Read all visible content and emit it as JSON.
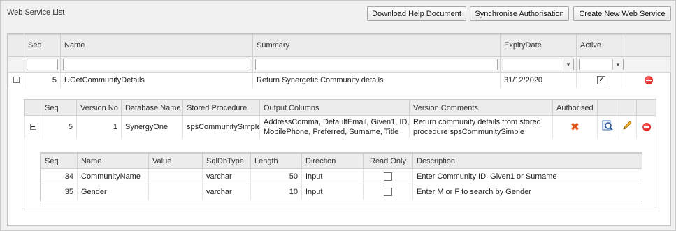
{
  "panel": {
    "title": "Web Service List",
    "buttons": {
      "download": "Download Help Document",
      "sync": "Synchronise Authorisation",
      "create": "Create New Web Service"
    }
  },
  "services": {
    "headers": [
      "Seq",
      "Name",
      "Summary",
      "ExpiryDate",
      "Active"
    ],
    "row": {
      "seq": "5",
      "name": "UGetCommunityDetails",
      "summary": "Return Synergetic Community details",
      "expiry": "31/12/2020",
      "active": true
    }
  },
  "versions": {
    "headers": [
      "Seq",
      "Version No",
      "Database Name",
      "Stored Procedure",
      "Output Columns",
      "Version Comments",
      "Authorised"
    ],
    "row": {
      "seq": "5",
      "version": "1",
      "database": "SynergyOne",
      "procedure": "spsCommunitySimple",
      "output_line1": "AddressComma, DefaultEmail, Given1, ID,",
      "output_line2": "MobilePhone, Preferred, Surname, Title",
      "comment_line1": "Return community details from stored",
      "comment_line2": "procedure spsCommunitySimple",
      "authorised": false
    }
  },
  "params": {
    "headers": [
      "Seq",
      "Name",
      "Value",
      "SqlDbType",
      "Length",
      "Direction",
      "Read Only",
      "Description"
    ],
    "rows": [
      {
        "seq": "34",
        "name": "CommunityName",
        "value": "",
        "type": "varchar",
        "length": "50",
        "direction": "Input",
        "readonly": false,
        "description": "Enter Community ID, Given1 or Surname"
      },
      {
        "seq": "35",
        "name": "Gender",
        "value": "",
        "type": "varchar",
        "length": "10",
        "direction": "Input",
        "readonly": false,
        "description": "Enter M or F to search by Gender"
      }
    ]
  },
  "icons": {
    "delete": "delete-icon",
    "not_authorised": "cross-icon",
    "view": "magnifier-icon",
    "edit": "pencil-icon",
    "collapse": "collapse-icon"
  },
  "colors": {
    "delete": "#d10000",
    "not_authorised": "#e4561b",
    "header_bg": "#ececec"
  }
}
